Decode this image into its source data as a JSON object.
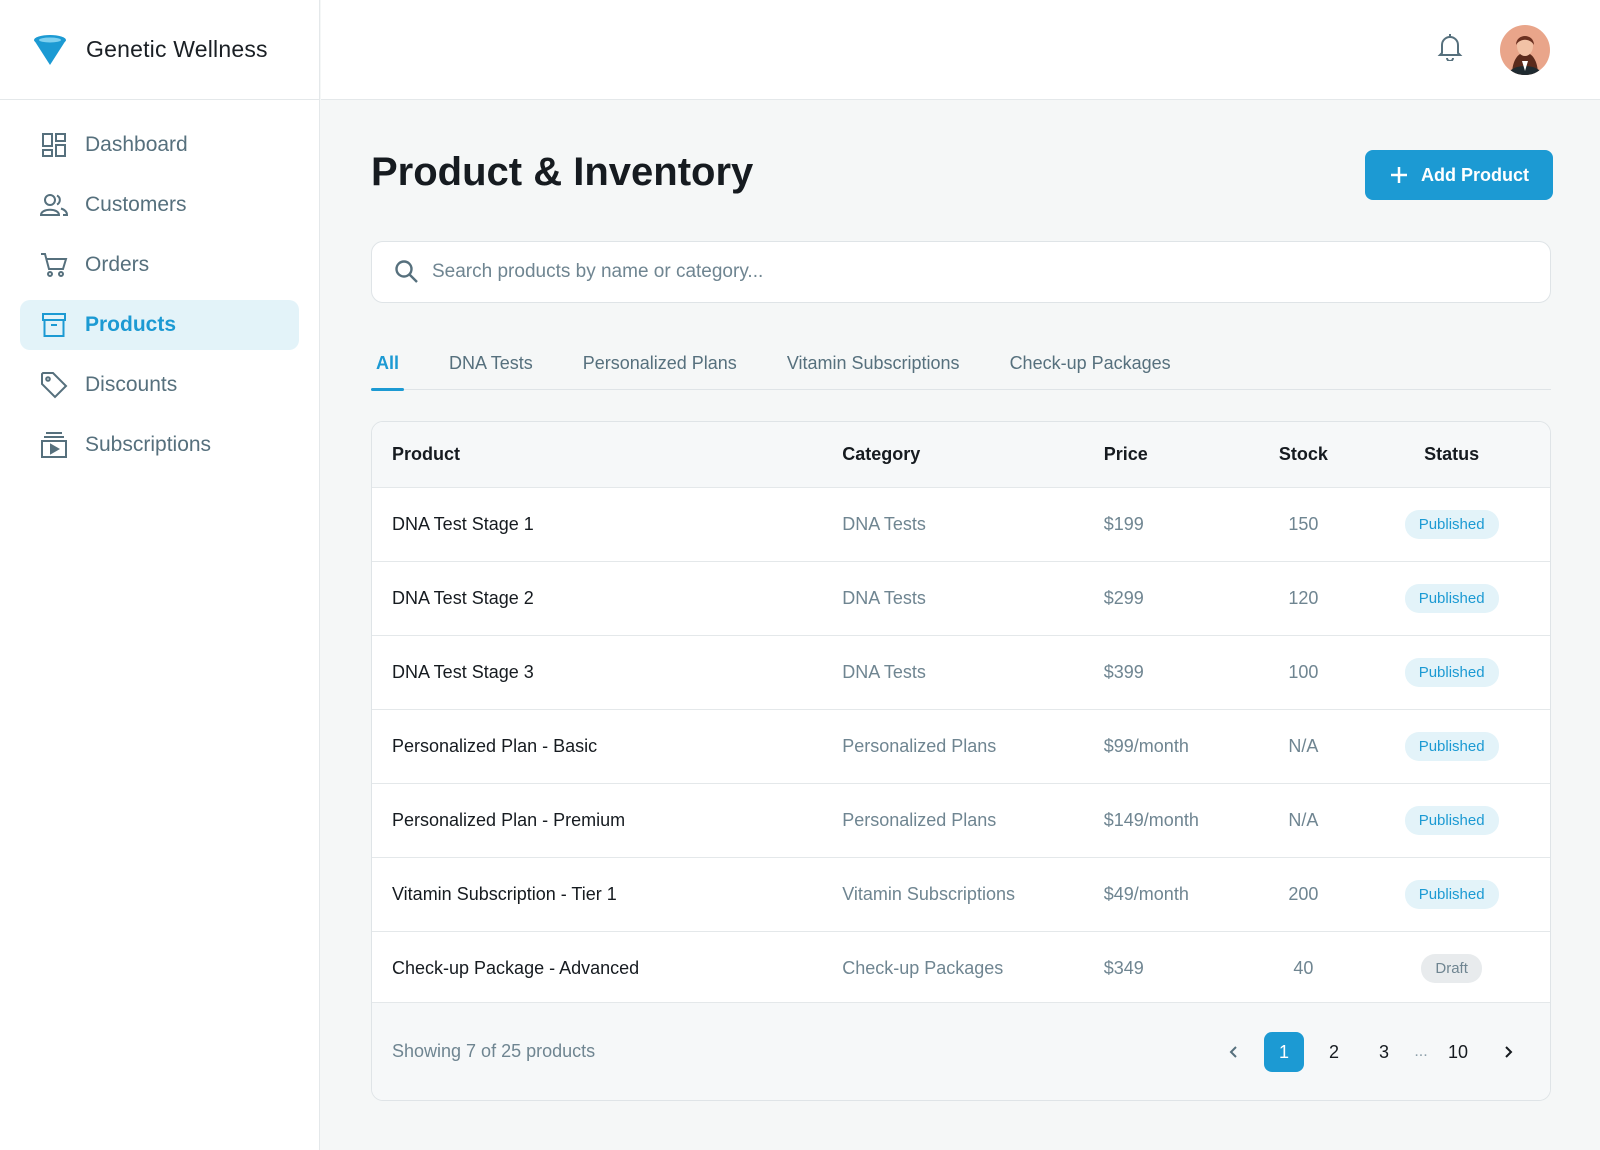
{
  "brand": {
    "name": "Genetic Wellness",
    "accent": "#1c9ad3"
  },
  "sidebar": {
    "items": [
      {
        "label": "Dashboard",
        "icon": "dashboard-icon",
        "active": false
      },
      {
        "label": "Customers",
        "icon": "users-icon",
        "active": false
      },
      {
        "label": "Orders",
        "icon": "cart-icon",
        "active": false
      },
      {
        "label": "Products",
        "icon": "archive-box-icon",
        "active": true
      },
      {
        "label": "Discounts",
        "icon": "tag-icon",
        "active": false
      },
      {
        "label": "Subscriptions",
        "icon": "subscriptions-icon",
        "active": false
      }
    ]
  },
  "topbar": {
    "bell_icon": "bell-icon",
    "avatar": "user-avatar"
  },
  "page": {
    "title": "Product & Inventory",
    "add_button_label": "Add Product"
  },
  "search": {
    "placeholder": "Search products by name or category...",
    "value": ""
  },
  "tabs": [
    {
      "label": "All",
      "active": true
    },
    {
      "label": "DNA Tests",
      "active": false
    },
    {
      "label": "Personalized Plans",
      "active": false
    },
    {
      "label": "Vitamin Subscriptions",
      "active": false
    },
    {
      "label": "Check-up Packages",
      "active": false
    }
  ],
  "table": {
    "headers": {
      "product": "Product",
      "category": "Category",
      "price": "Price",
      "stock": "Stock",
      "status": "Status"
    },
    "rows": [
      {
        "product": "DNA Test Stage 1",
        "category": "DNA Tests",
        "price": "$199",
        "stock": "150",
        "status": "Published"
      },
      {
        "product": "DNA Test Stage 2",
        "category": "DNA Tests",
        "price": "$299",
        "stock": "120",
        "status": "Published"
      },
      {
        "product": "DNA Test Stage 3",
        "category": "DNA Tests",
        "price": "$399",
        "stock": "100",
        "status": "Published"
      },
      {
        "product": "Personalized Plan - Basic",
        "category": "Personalized Plans",
        "price": "$99/month",
        "stock": "N/A",
        "status": "Published"
      },
      {
        "product": "Personalized Plan - Premium",
        "category": "Personalized Plans",
        "price": "$149/month",
        "stock": "N/A",
        "status": "Published"
      },
      {
        "product": "Vitamin Subscription - Tier 1",
        "category": "Vitamin Subscriptions",
        "price": "$49/month",
        "stock": "200",
        "status": "Published"
      },
      {
        "product": "Check-up Package - Advanced",
        "category": "Check-up Packages",
        "price": "$349",
        "stock": "40",
        "status": "Draft"
      }
    ]
  },
  "footer": {
    "showing": "Showing 7 of 25 products",
    "pages": [
      "1",
      "2",
      "3"
    ],
    "ellipsis": "...",
    "last_page": "10",
    "current_page": "1"
  }
}
